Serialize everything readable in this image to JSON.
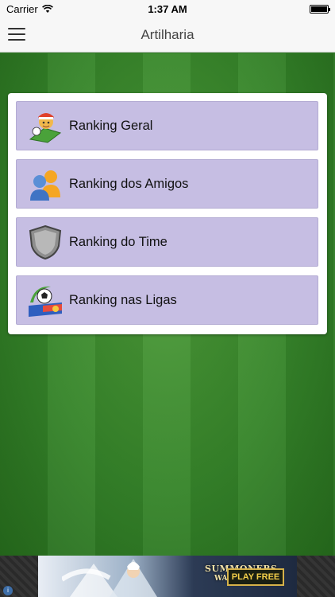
{
  "status_bar": {
    "carrier": "Carrier",
    "time": "1:37 AM"
  },
  "nav": {
    "title": "Artilharia",
    "menu_icon": "hamburger-menu-icon"
  },
  "rankings": [
    {
      "label": "Ranking Geral",
      "icon": "soccer-player-icon"
    },
    {
      "label": "Ranking dos Amigos",
      "icon": "friends-icon"
    },
    {
      "label": "Ranking do Time",
      "icon": "shield-icon"
    },
    {
      "label": "Ranking nas Ligas",
      "icon": "league-ball-icon"
    }
  ],
  "ad": {
    "title": "SUMMONERS",
    "subtitle": "WAR",
    "cta": "PLAY FREE",
    "info_icon": "ad-info-icon"
  },
  "colors": {
    "item_background": "#c6bee3",
    "field_green": "#36852a",
    "nav_background": "#f7f7f7"
  }
}
